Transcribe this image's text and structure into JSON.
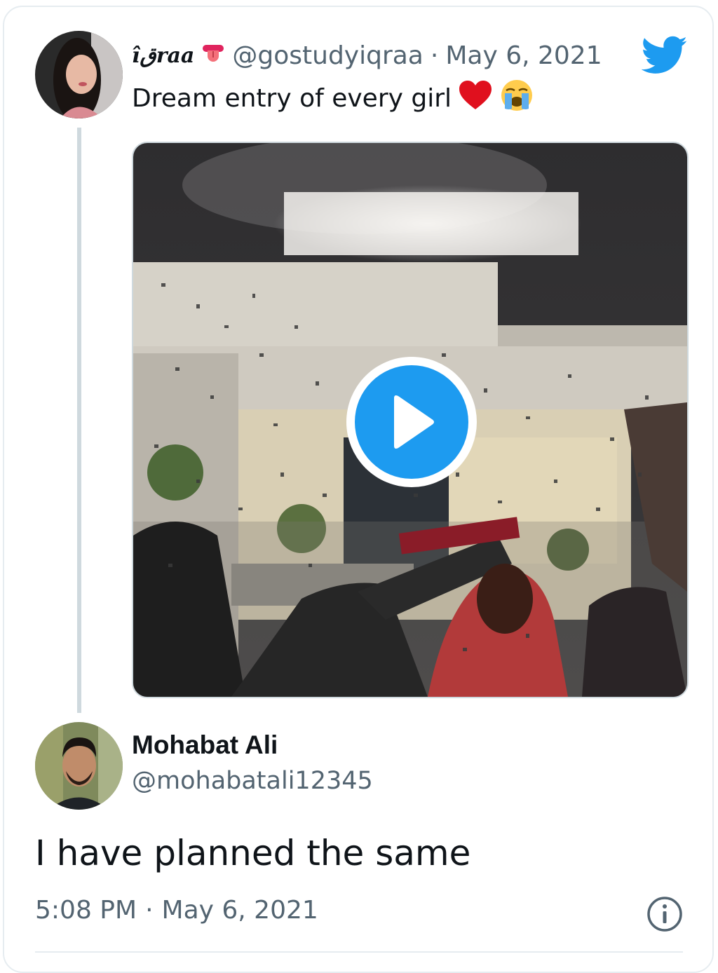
{
  "tweet": {
    "display_name": "îقraa",
    "handle": "@gostudyiqraa",
    "separator": "·",
    "date": "May 6, 2021",
    "text": "Dream entry of every girl",
    "emojis": [
      "red-heart-emoji",
      "loudly-crying-face-emoji"
    ],
    "media": {
      "type": "video",
      "icon": "play-icon"
    }
  },
  "reply": {
    "display_name": "Mohabat Ali",
    "handle": "@mohabatali12345",
    "text": "I have planned the same",
    "time": "5:08 PM",
    "separator": "·",
    "date": "May 6, 2021"
  },
  "colors": {
    "accent": "#1d9bf0",
    "text_primary": "#0f1419",
    "text_secondary": "#536471",
    "border": "#cfd9de"
  }
}
